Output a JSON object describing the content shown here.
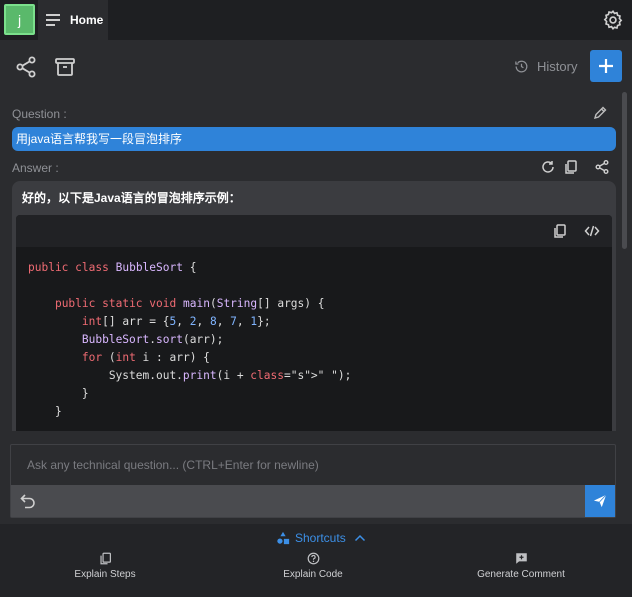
{
  "colors": {
    "accent": "#2f83d9",
    "avatar": "#5ab96b"
  },
  "topbar": {
    "avatar_letter": "j",
    "home_label": "Home",
    "menu_icon": "menu-lines-icon",
    "settings_icon": "gear-icon"
  },
  "toolbar": {
    "share_icon": "share-icon",
    "delete_icon": "trash-icon",
    "history_label": "History",
    "history_icon": "history-clock-icon",
    "new_icon": "plus-icon"
  },
  "conversation": {
    "question_label": "Question :",
    "question_text": "用java语言帮我写一段冒泡排序",
    "answer_label": "Answer :",
    "answer_intro": "好的，以下是Java语言的冒泡排序示例：",
    "code_lines": [
      "public class BubbleSort {",
      "",
      "    public static void main(String[] args) {",
      "        int[] arr = {5, 2, 8, 7, 1};",
      "        BubbleSort.sort(arr);",
      "        for (int i : arr) {",
      "            System.out.print(i + \" \");",
      "        }",
      "    }"
    ]
  },
  "input": {
    "placeholder": "Ask any technical question... (CTRL+Enter for newline)",
    "value": ""
  },
  "shortcuts": {
    "title": "Shortcuts",
    "items": [
      {
        "label": "Explain Steps",
        "icon": "copy-doc-icon"
      },
      {
        "label": "Explain Code",
        "icon": "question-bubble-icon"
      },
      {
        "label": "Generate Comment",
        "icon": "comment-plus-icon"
      }
    ]
  }
}
